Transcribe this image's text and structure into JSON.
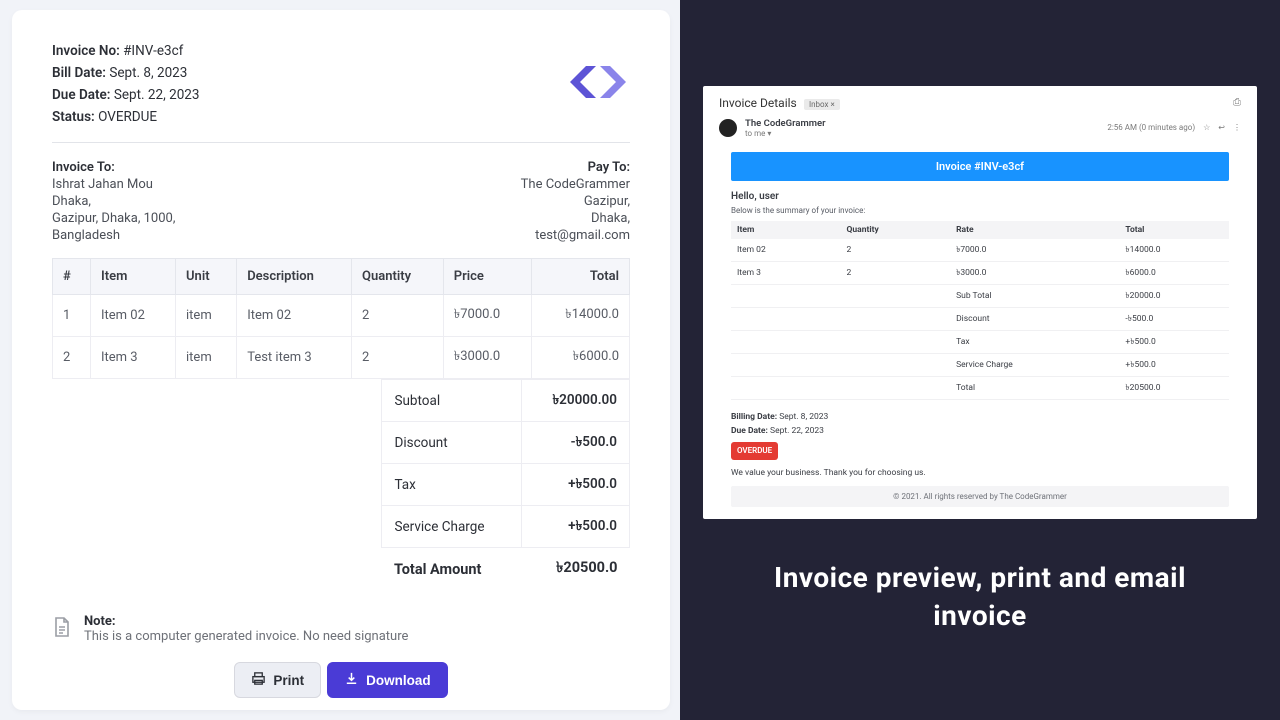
{
  "invoice": {
    "labels": {
      "invoice_no": "Invoice No:",
      "bill_date": "Bill Date:",
      "due_date": "Due Date:",
      "status": "Status:",
      "invoice_to": "Invoice To:",
      "pay_to": "Pay To:",
      "note": "Note:",
      "subtotal": "Subtoal",
      "discount": "Discount",
      "tax": "Tax",
      "service_charge": "Service Charge",
      "total_amount": "Total Amount"
    },
    "number": "#INV-e3cf",
    "bill_date": "Sept. 8, 2023",
    "due_date": "Sept. 22, 2023",
    "status": "OVERDUE",
    "to": {
      "name": "Ishrat Jahan Mou",
      "line1": "Dhaka,",
      "line2": "Gazipur, Dhaka, 1000,",
      "line3": "Bangladesh"
    },
    "from": {
      "name": "The CodeGrammer",
      "line1": "Gazipur,",
      "line2": "Dhaka,",
      "line3": "test@gmail.com"
    },
    "cols": {
      "idx": "#",
      "item": "Item",
      "unit": "Unit",
      "desc": "Description",
      "qty": "Quantity",
      "price": "Price",
      "total": "Total"
    },
    "rows": [
      {
        "idx": "1",
        "item": "Item 02",
        "unit": "item",
        "desc": "Item 02",
        "qty": "2",
        "price": "৳7000.0",
        "total": "৳14000.0"
      },
      {
        "idx": "2",
        "item": "Item 3",
        "unit": "item",
        "desc": "Test item 3",
        "qty": "2",
        "price": "৳3000.0",
        "total": "৳6000.0"
      }
    ],
    "summary": {
      "subtotal": "৳20000.00",
      "discount": "-৳500.0",
      "tax": "+৳500.0",
      "service_charge": "+৳500.0",
      "total": "৳20500.0"
    },
    "note_text": "This is a computer generated invoice. No need signature",
    "actions": {
      "print": "Print",
      "download": "Download"
    }
  },
  "email": {
    "subject": "Invoice Details",
    "inbox_chip": "Inbox ×",
    "sender": "The CodeGrammer",
    "to_me": "to me ▾",
    "time": "2:56 AM (0 minutes ago)",
    "banner": "Invoice #INV-e3cf",
    "hello": "Hello, user",
    "summary_line": "Below is the summary of your invoice:",
    "cols": {
      "item": "Item",
      "qty": "Quantity",
      "rate": "Rate",
      "total": "Total"
    },
    "rows": [
      {
        "item": "Item 02",
        "qty": "2",
        "rate": "৳7000.0",
        "total": "৳14000.0"
      },
      {
        "item": "Item 3",
        "qty": "2",
        "rate": "৳3000.0",
        "total": "৳6000.0"
      }
    ],
    "totals": [
      {
        "k": "Sub Total",
        "v": "৳20000.0"
      },
      {
        "k": "Discount",
        "v": "-৳500.0"
      },
      {
        "k": "Tax",
        "v": "+৳500.0"
      },
      {
        "k": "Service Charge",
        "v": "+৳500.0"
      },
      {
        "k": "Total",
        "v": "৳20500.0"
      }
    ],
    "billing_lbl": "Billing Date:",
    "billing_val": "Sept. 8, 2023",
    "due_lbl": "Due Date:",
    "due_val": "Sept. 22, 2023",
    "overdue": "OVERDUE",
    "thanks": "We value your business. Thank you for choosing us.",
    "footer": "© 2021. All rights reserved by The CodeGrammer"
  },
  "caption": "Invoice preview, print and email invoice",
  "colors": {
    "brand": "#5d54d6",
    "accent": "#4a3bd6",
    "email_blue": "#1893ff",
    "danger": "#e43b33",
    "dark_bg": "#232336"
  }
}
